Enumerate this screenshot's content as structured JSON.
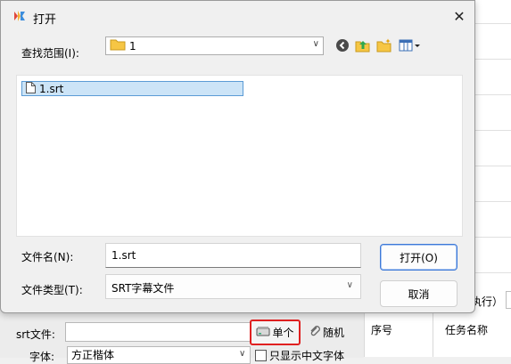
{
  "dialog": {
    "title": "打开",
    "close_icon": "close-icon",
    "look_in": {
      "label": "查找范围(I):",
      "value": "1"
    },
    "toolbar": [
      "back-icon",
      "up-folder-icon",
      "new-folder-icon",
      "view-menu-icon"
    ],
    "files": [
      {
        "name": "1.srt",
        "selected": true
      }
    ],
    "file_name": {
      "label": "文件名(N):",
      "value": "1.srt"
    },
    "file_type": {
      "label": "文件类型(T):",
      "value": "SRT字幕文件"
    },
    "open_label": "打开(O)",
    "cancel_label": "取消"
  },
  "background": {
    "exec_text": "执行）",
    "srt_label": "srt文件:",
    "single_label": "单个",
    "random_label": "随机",
    "font_label": "字体:",
    "font_value": "方正楷体",
    "chinese_only_label": "只显示中文字体",
    "table_columns": [
      "序号",
      "任务名称"
    ],
    "highlight_color": "#e02020"
  }
}
